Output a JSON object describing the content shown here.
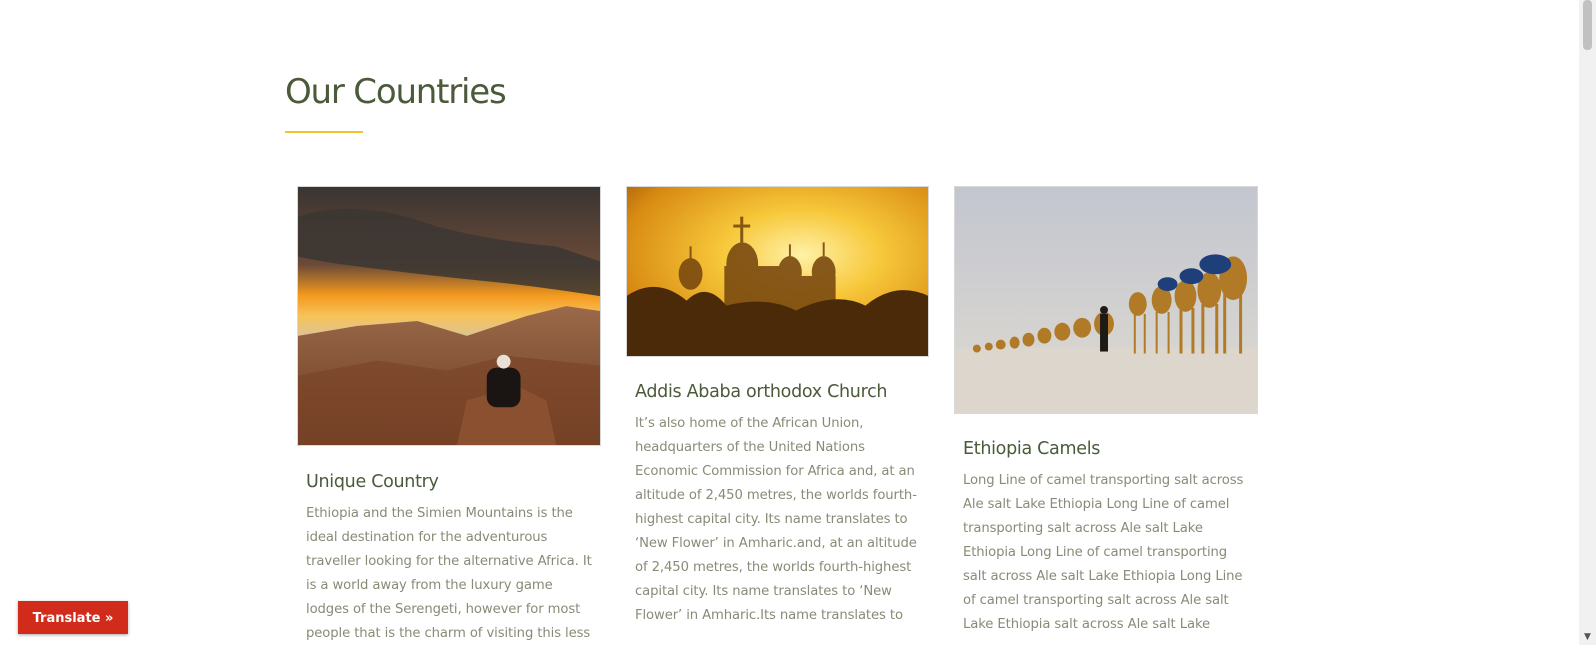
{
  "section": {
    "title": "Our Countries"
  },
  "cards": [
    {
      "title": "Unique Country",
      "text": "Ethiopia and the Simien Mountains is the ideal destination for the adventurous traveller looking for the alternative Africa. It is a world away from the luxury game lodges of the Serengeti, however for most people that is the charm of visiting this less"
    },
    {
      "title": "Addis Ababa orthodox Church",
      "text": "It’s also home of the African Union, headquarters of the United Nations Economic Commission for Africa and, at an altitude of 2,450 metres, the worlds fourth-highest capital city. Its name translates to ‘New Flower’ in Amharic.and, at an altitude of 2,450 metres, the worlds fourth-highest capital city. Its name translates to ‘New Flower’ in Amharic.Its name translates to"
    },
    {
      "title": "Ethiopia Camels",
      "text": "Long Line of camel transporting salt across Ale salt Lake Ethiopia Long Line of camel transporting salt across Ale salt Lake Ethiopia Long Line of camel transporting salt across Ale salt Lake Ethiopia Long Line of camel transporting salt across Ale salt Lake Ethiopia salt across Ale salt Lake"
    }
  ],
  "translate": {
    "label": "Translate »"
  },
  "colors": {
    "heading": "#4a5a3a",
    "accent": "#f2c230",
    "body_text": "#8a8a78",
    "translate_bg": "#d12b1c"
  }
}
